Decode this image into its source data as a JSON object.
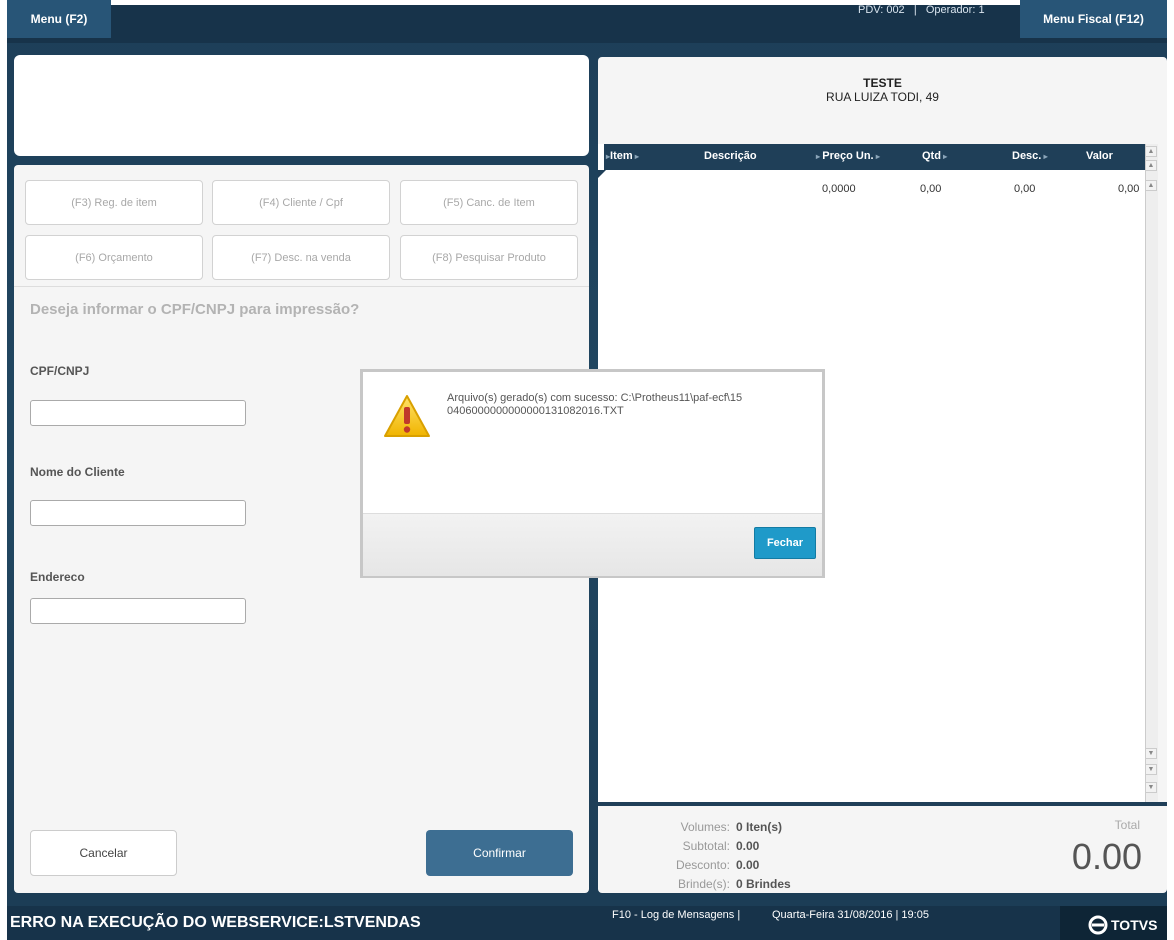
{
  "header": {
    "menu_button": "Menu (F2)",
    "pdv_info": "PDV: 002   |   Operador: 1",
    "fiscal_menu_button": "Menu Fiscal (F12)"
  },
  "function_buttons": [
    {
      "label": "(F3) Reg. de item"
    },
    {
      "label": "(F4) Cliente / Cpf"
    },
    {
      "label": "(F5) Canc. de Item"
    },
    {
      "label": "(F6) Orçamento"
    },
    {
      "label": "(F7) Desc. na venda"
    },
    {
      "label": "(F8) Pesquisar Produto"
    }
  ],
  "form": {
    "question": "Deseja informar o CPF/CNPJ para impressão?",
    "cpf_label": "CPF/CNPJ",
    "cpf_value": "",
    "name_label": "Nome do Cliente",
    "name_value": "",
    "address_label": "Endereco",
    "address_value": "",
    "cancel_button": "Cancelar",
    "confirm_button": "Confirmar"
  },
  "store": {
    "name": "TESTE",
    "address": "RUA LUIZA TODI, 49"
  },
  "grid": {
    "columns": [
      "Item",
      "Descrição",
      "Preço Un.",
      "Qtd",
      "Desc.",
      "Valor"
    ],
    "rows": [
      {
        "item": "",
        "descricao": "",
        "preco": "0,0000",
        "qtd": "0,00",
        "desc": "0,00",
        "valor": "0,00"
      }
    ]
  },
  "totals": {
    "volumes_label": "Volumes:",
    "volumes_value": "0 Iten(s)",
    "subtotal_label": "Subtotal:",
    "subtotal_value": "0.00",
    "desconto_label": "Desconto:",
    "desconto_value": "0.00",
    "brindes_label": "Brinde(s):",
    "brindes_value": "0 Brindes",
    "total_label": "Total",
    "total_value": "0.00"
  },
  "dialog": {
    "message": "Arquivo(s) gerado(s) com sucesso: C:\\Protheus11\\paf-ecf\\150406000000000000131082016.TXT",
    "close_button": "Fechar",
    "icon": "warning-icon"
  },
  "status": {
    "error_message": "ERRO NA EXECUÇÃO DO WEBSERVICE:LSTVENDAS",
    "log_link": "F10 - Log de Mensagens |",
    "datetime": "Quarta-Feira 31/08/2016 | 19:05",
    "brand": "TOTVS"
  },
  "colors": {
    "background": "#1f4360",
    "accent_button": "#3d6e92",
    "dialog_button": "#1f9ac9",
    "warning": "#f2c200"
  }
}
